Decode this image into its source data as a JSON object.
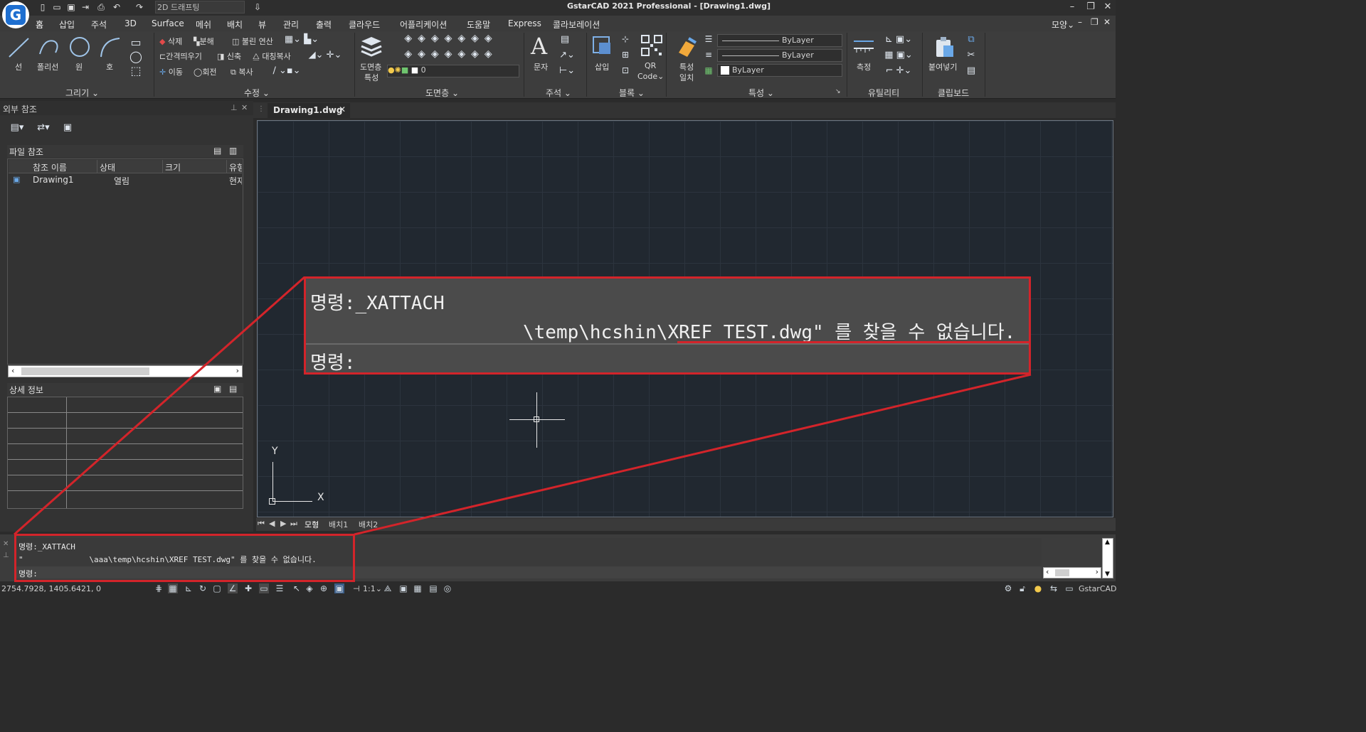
{
  "title_bar": {
    "workspace": "2D 드래프팅",
    "app_title": "GstarCAD 2021 Professional - [Drawing1.dwg]"
  },
  "menu": {
    "items": [
      "홈",
      "삽입",
      "주석",
      "3D",
      "Surface",
      "메쉬",
      "배치",
      "뷰",
      "관리",
      "출력",
      "클라우드",
      "어플리케이션",
      "도움말",
      "Express",
      "콜라보레이션"
    ],
    "right": "모양"
  },
  "ribbon": {
    "draw": {
      "title": "그리기",
      "line": "선",
      "polyline": "폴리선",
      "circle": "원",
      "arc": "호"
    },
    "modify": {
      "title": "수정",
      "delete": "삭제",
      "explode": "분해",
      "boolean": "불린 연산",
      "offset": "간격띄우기",
      "stretch": "신축",
      "mirror": "대칭복사",
      "move": "이동",
      "rotate": "회전",
      "copy": "복사"
    },
    "layers": {
      "title": "도면층",
      "properties_l1": "도면층",
      "properties_l2": "특성",
      "current": "0"
    },
    "annotation": {
      "title": "주석",
      "text": "문자"
    },
    "block": {
      "title": "블록",
      "insert": "삽입",
      "qr_l1": "QR",
      "qr_l2": "Code"
    },
    "properties": {
      "title": "특성",
      "match_l1": "특성",
      "match_l2": "일치",
      "linetype": "ByLayer",
      "lineweight": "ByLayer",
      "color": "ByLayer"
    },
    "utilities": {
      "title": "유틸리티",
      "measure": "측정"
    },
    "clipboard": {
      "title": "클립보드",
      "paste": "붙여넣기"
    }
  },
  "xref_panel": {
    "title": "외부 참조",
    "file_refs": {
      "title": "파일 참조",
      "columns": [
        "참조 이름",
        "상태",
        "크기",
        "유형"
      ],
      "rows": [
        {
          "name": "Drawing1",
          "status": "열림",
          "size": "",
          "type": "현재"
        }
      ]
    },
    "details": {
      "title": "상세 정보"
    }
  },
  "drawing": {
    "tab": "Drawing1.dwg",
    "ucs_y": "Y",
    "ucs_x": "X",
    "layout_tabs": [
      "모형",
      "배치1",
      "배치2"
    ]
  },
  "command": {
    "line1": "명령:_XATTACH",
    "line2": "\"              \\aaa\\temp\\hcshin\\XREF TEST.dwg\" 를 찾을 수 없습니다.",
    "prompt": "명령:"
  },
  "zoom_callout": {
    "line1": "명령:_XATTACH",
    "line2": "\\temp\\hcshin\\XREF TEST.dwg\" 를 찾을 수 없습니다.",
    "prompt": "명령:"
  },
  "status_bar": {
    "coords": "2754.7928, 1405.6421, 0",
    "scale": "1:1",
    "app": "GstarCAD"
  },
  "colors": {
    "highlight_red": "#d3242a",
    "canvas_bg": "#212830",
    "accent_blue": "#1e6fd0"
  }
}
